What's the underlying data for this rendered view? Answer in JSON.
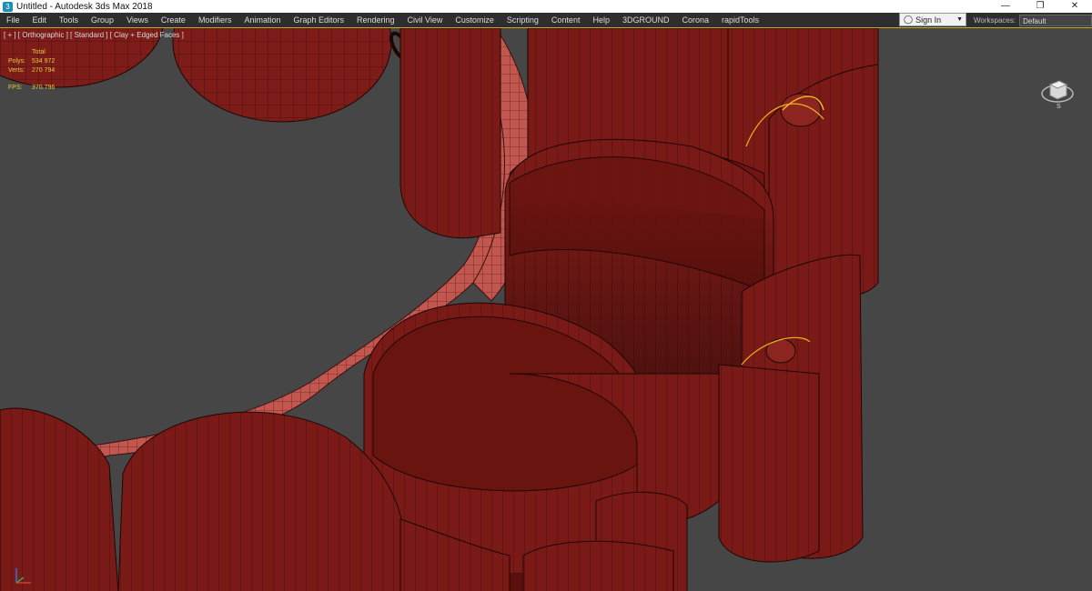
{
  "window": {
    "title": "Untitled - Autodesk 3ds Max 2018",
    "controls": [
      "—",
      "❐",
      "✕"
    ]
  },
  "menu": {
    "items": [
      "File",
      "Edit",
      "Tools",
      "Group",
      "Views",
      "Create",
      "Modifiers",
      "Animation",
      "Graph Editors",
      "Rendering",
      "Civil View",
      "Customize",
      "Scripting",
      "Content",
      "Help",
      "3DGROUND",
      "Corona",
      "rapidTools"
    ]
  },
  "signin": {
    "label": "Sign In",
    "icon": "person-icon"
  },
  "workspaces": {
    "label": "Workspaces:",
    "value": "Default"
  },
  "viewport": {
    "label": "[ + ] [ Orthographic ] [ Standard ] [ Clay + Edged Faces ]",
    "stats": {
      "total_label": "Total",
      "polys_label": "Polys:",
      "polys_value": "534 972",
      "verts_label": "Verts:",
      "verts_value": "270 794",
      "fps_label": "FPS:",
      "fps_value": "370.796"
    },
    "viewcube_label": "S"
  },
  "colors": {
    "model": "#7a1a17",
    "wire": "#1b0705",
    "selection": "#f0b21c",
    "background": "#464646"
  }
}
